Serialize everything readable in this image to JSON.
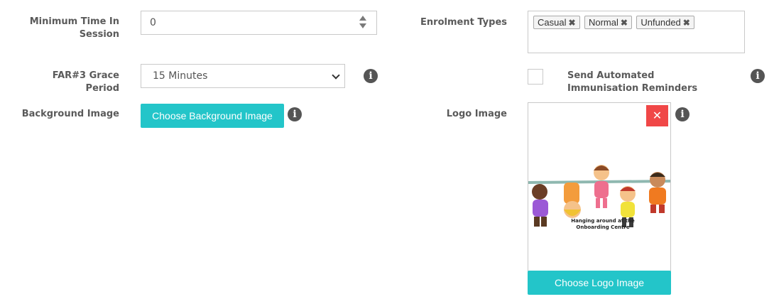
{
  "fields": {
    "min_time": {
      "label": "Minimum Time In Session",
      "value": "0"
    },
    "grace_period": {
      "label": "FAR#3 Grace Period",
      "value": "15 Minutes"
    },
    "background_image": {
      "label": "Background Image",
      "button": "Choose Background Image"
    },
    "enrolment_types": {
      "label": "Enrolment Types",
      "tags": [
        "Casual",
        "Normal",
        "Unfunded"
      ],
      "remove_glyph": "✖"
    },
    "reminders": {
      "label": "Send Automated Immunisation Reminders",
      "checked": false
    },
    "logo_image": {
      "label": "Logo Image",
      "button": "Choose Logo Image",
      "remove_glyph": "✕",
      "caption": "Hanging around at the Onboarding Centre"
    }
  },
  "info_glyph": "i",
  "colors": {
    "accent": "#23c5c9",
    "danger": "#f04747",
    "info_icon": "#555555"
  }
}
